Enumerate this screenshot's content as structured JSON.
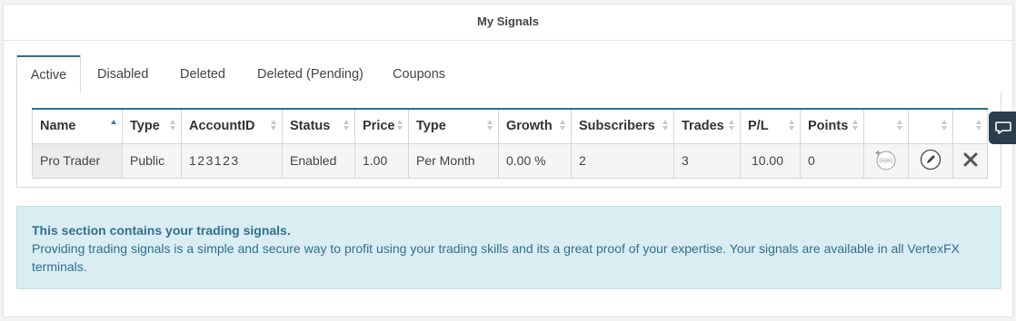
{
  "page": {
    "title": "My Signals"
  },
  "tabs": [
    {
      "label": "Active",
      "active": true
    },
    {
      "label": "Disabled",
      "active": false
    },
    {
      "label": "Deleted",
      "active": false
    },
    {
      "label": "Deleted (Pending)",
      "active": false
    },
    {
      "label": "Coupons",
      "active": false
    }
  ],
  "table": {
    "columns": [
      "Name",
      "Type",
      "AccountID",
      "Status",
      "Price",
      "Type",
      "Growth",
      "Subscribers",
      "Trades",
      "P/L",
      "Points",
      "",
      "",
      ""
    ],
    "sorted_column": "Name",
    "sort_direction": "asc",
    "rows": [
      {
        "name": "Pro Trader",
        "type": "Public",
        "account_id": "123123",
        "status": "Enabled",
        "price": "1.00",
        "period": "Per Month",
        "growth": "0.00 %",
        "subscribers": "2",
        "trades": "3",
        "pl": "10.00",
        "points": "0",
        "actions": [
          "add-coupon-icon",
          "edit-icon",
          "delete-icon"
        ]
      }
    ]
  },
  "info": {
    "heading": "This section contains your trading signals.",
    "body": "Providing trading signals is a simple and secure way to profit using your trading skills and its a great proof of your expertise. Your signals are available in all VertexFX terminals."
  },
  "chat": {
    "icon": "chat-bubble-icon"
  },
  "colors": {
    "accent": "#2f6e8c",
    "info_bg": "#d9edf3",
    "info_text": "#31708f",
    "chat_bg": "#2c3e4c"
  }
}
